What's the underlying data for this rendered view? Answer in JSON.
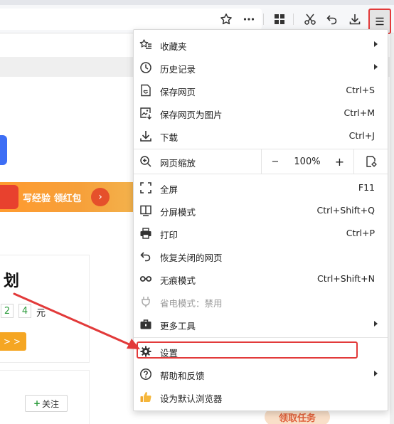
{
  "menu": {
    "items": [
      {
        "label": "收藏夹",
        "icon": "favorites-star-list-icon",
        "shortcut": "",
        "submenu": true
      },
      {
        "label": "历史记录",
        "icon": "history-clock-icon",
        "shortcut": "",
        "submenu": true
      },
      {
        "label": "保存网页",
        "icon": "save-page-icon",
        "shortcut": "Ctrl+S",
        "submenu": false
      },
      {
        "label": "保存网页为图片",
        "icon": "save-as-image-icon",
        "shortcut": "Ctrl+M",
        "submenu": false
      },
      {
        "label": "下载",
        "icon": "download-icon",
        "shortcut": "Ctrl+J",
        "submenu": false
      }
    ],
    "zoom": {
      "label": "网页缩放",
      "minus": "−",
      "value": "100%",
      "plus": "+"
    },
    "items2": [
      {
        "label": "全屏",
        "icon": "fullscreen-icon",
        "shortcut": "F11"
      },
      {
        "label": "分屏模式",
        "icon": "split-screen-icon",
        "shortcut": "Ctrl+Shift+Q"
      },
      {
        "label": "打印",
        "icon": "printer-icon",
        "shortcut": "Ctrl+P"
      },
      {
        "label": "恢复关闭的网页",
        "icon": "restore-undo-icon",
        "shortcut": ""
      },
      {
        "label": "无痕模式",
        "icon": "incognito-glasses-icon",
        "shortcut": "Ctrl+Shift+N"
      },
      {
        "label": "省电模式：禁用",
        "icon": "power-plug-icon",
        "shortcut": ""
      },
      {
        "label": "更多工具",
        "icon": "toolbox-icon",
        "shortcut": ""
      }
    ],
    "items3": [
      {
        "label": "设置",
        "icon": "gear-icon"
      },
      {
        "label": "帮助和反馈",
        "icon": "help-question-icon"
      },
      {
        "label": "设为默认浏览器",
        "icon": "thumbs-up-icon"
      }
    ]
  },
  "page": {
    "banner_text": "写经验 领红包",
    "card_title": "划",
    "digits": [
      "2",
      "4"
    ],
    "unit": "元",
    "orange_btn": "> >",
    "follow": "关注",
    "follow_plus": "+",
    "task": "领取任务"
  },
  "colors": {
    "highlight": "#e23a3a",
    "accent_orange": "#f5a623"
  }
}
